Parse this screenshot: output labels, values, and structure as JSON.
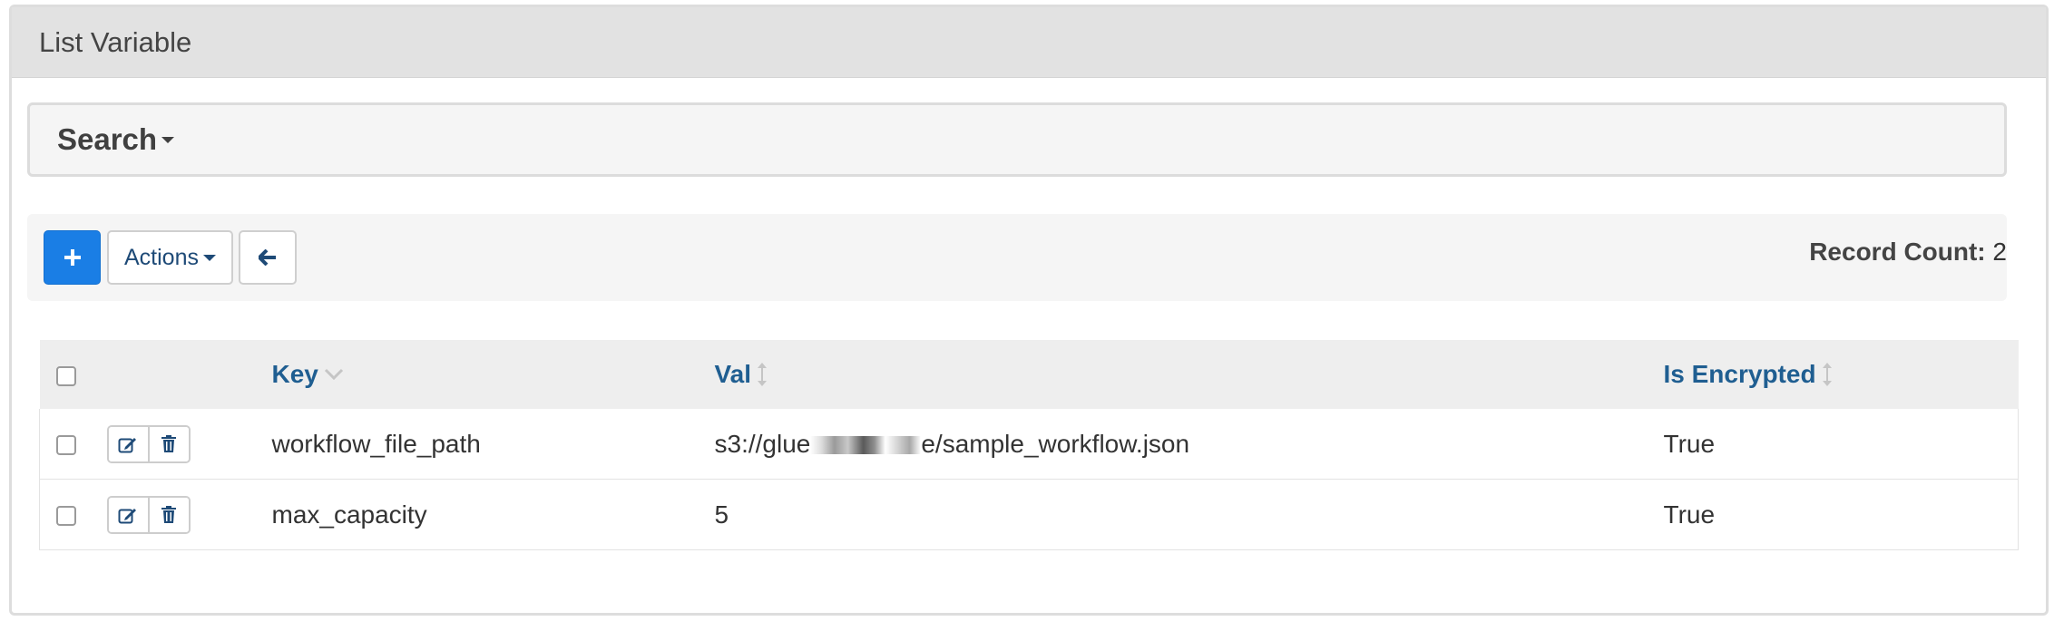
{
  "panel": {
    "title": "List Variable"
  },
  "search": {
    "label": "Search"
  },
  "toolbar": {
    "add_icon": "plus-icon",
    "actions_label": "Actions",
    "back_icon": "arrow-left-icon",
    "record_count_label": "Record Count:",
    "record_count_value": "2"
  },
  "table": {
    "columns": [
      {
        "label": "Key",
        "sort_icon": "chevron-down-icon"
      },
      {
        "label": "Val",
        "sort_icon": "sort-icon"
      },
      {
        "label": "Is Encrypted",
        "sort_icon": "sort-icon"
      }
    ],
    "rows": [
      {
        "key": "workflow_file_path",
        "val_prefix": "s3://glue",
        "val_suffix": "e/sample_workflow.json",
        "val_redacted": true,
        "is_encrypted": "True"
      },
      {
        "key": "max_capacity",
        "val": "5",
        "is_encrypted": "True"
      }
    ]
  },
  "colors": {
    "primary": "#1a7ee5",
    "link": "#1f5e91",
    "heading_bg": "#e2e2e2",
    "well_bg": "#f5f5f5"
  }
}
